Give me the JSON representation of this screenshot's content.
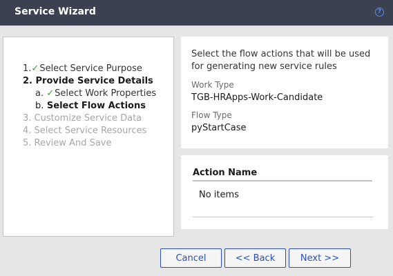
{
  "window": {
    "title": "Service Wizard",
    "help_icon": "help-icon",
    "help_glyph": "?"
  },
  "steps": [
    {
      "number": "1.",
      "check": "✓",
      "label": "Select Service Purpose"
    },
    {
      "number": "2.",
      "label": "Provide Service Details"
    },
    {
      "number": "a.",
      "check": "✓",
      "label": "Select Work Properties"
    },
    {
      "number": "b.",
      "label": "Select Flow Actions"
    },
    {
      "number": "3.",
      "label": "Customize Service Data"
    },
    {
      "number": "4.",
      "label": "Select Service Resources"
    },
    {
      "number": "5.",
      "label": "Review And Save"
    }
  ],
  "info": {
    "description": "Select the flow actions that will be used for generating new service rules",
    "work_type_label": "Work Type",
    "work_type_value": "TGB-HRApps-Work-Candidate",
    "flow_type_label": "Flow Type",
    "flow_type_value": "pyStartCase"
  },
  "grid": {
    "header": "Action Name",
    "empty_text": "No items"
  },
  "buttons": {
    "cancel": "Cancel",
    "back": "<< Back",
    "next": "Next >>"
  },
  "colors": {
    "titlebar": "#3b4151",
    "check": "#3a9e1f",
    "button_border": "#2c4fb6"
  }
}
